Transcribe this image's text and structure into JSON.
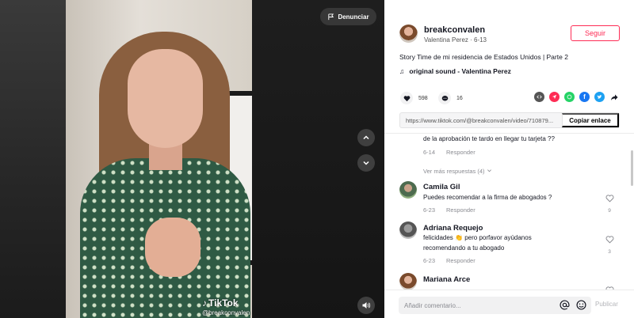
{
  "video": {
    "report_label": "Denunciar",
    "watermark_logo": "TikTok",
    "watermark_user": "@breakconvalen"
  },
  "author": {
    "username": "breakconvalen",
    "subtitle": "Valentina Perez · 6-13",
    "follow_label": "Seguir"
  },
  "post": {
    "description": "Story Time de mi residencia de Estados Unidos | Parte 2",
    "sound": "original sound - Valentina Perez",
    "likes": "598",
    "comments": "16",
    "link": "https://www.tiktok.com/@breakconvalen/video/710879...",
    "copy_label": "Copiar enlace"
  },
  "share_colors": {
    "embed": "#555555",
    "send": "#fe2c55",
    "whatsapp": "#25d366",
    "facebook": "#1877f2",
    "twitter": "#1da1f2"
  },
  "comment_list": {
    "partial_text": "de la aprobación te tardo en llegar tu tarjeta ??",
    "partial_date": "6-14",
    "reply_label": "Responder",
    "more_replies": "Ver más respuestas (4)",
    "items": [
      {
        "name": "Camila Gil",
        "text": "Puedes recomendar a la firma de abogados ?",
        "date": "6-23",
        "likes": "9"
      },
      {
        "name": "Adriana Requejo",
        "text_line1": "felicidades 👏 pero porfavor ayúdanos",
        "text_line2": "recomendando a tu abogado",
        "date": "6-23",
        "likes": "3"
      },
      {
        "name": "Mariana Arce"
      }
    ]
  },
  "composer": {
    "placeholder": "Añadir comentario...",
    "post_label": "Publicar"
  }
}
